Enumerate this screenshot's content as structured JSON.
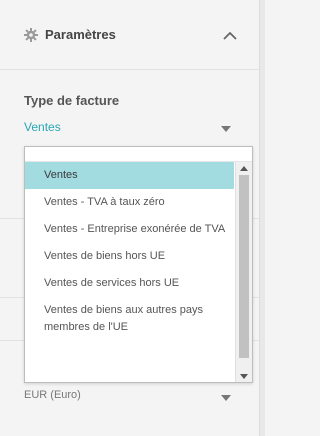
{
  "header": {
    "title": "Paramètres",
    "icon": "gear-icon",
    "collapse_icon": "chevron-up-icon"
  },
  "invoice_type": {
    "label": "Type de facture",
    "value": "Ventes"
  },
  "currency": {
    "value": "EUR (Euro)"
  },
  "dropdown": {
    "options": [
      "Ventes",
      "Ventes - TVA à taux zéro",
      "Ventes - Entreprise exonérée de TVA",
      "Ventes de biens hors UE",
      "Ventes de services hors UE",
      "Ventes de biens aux autres pays membres de l'UE"
    ],
    "selected_index": 0
  },
  "colors": {
    "accent": "#2aa7b3",
    "selected_bg": "#a2dbe0",
    "panel_bg": "#f4f4f4"
  }
}
